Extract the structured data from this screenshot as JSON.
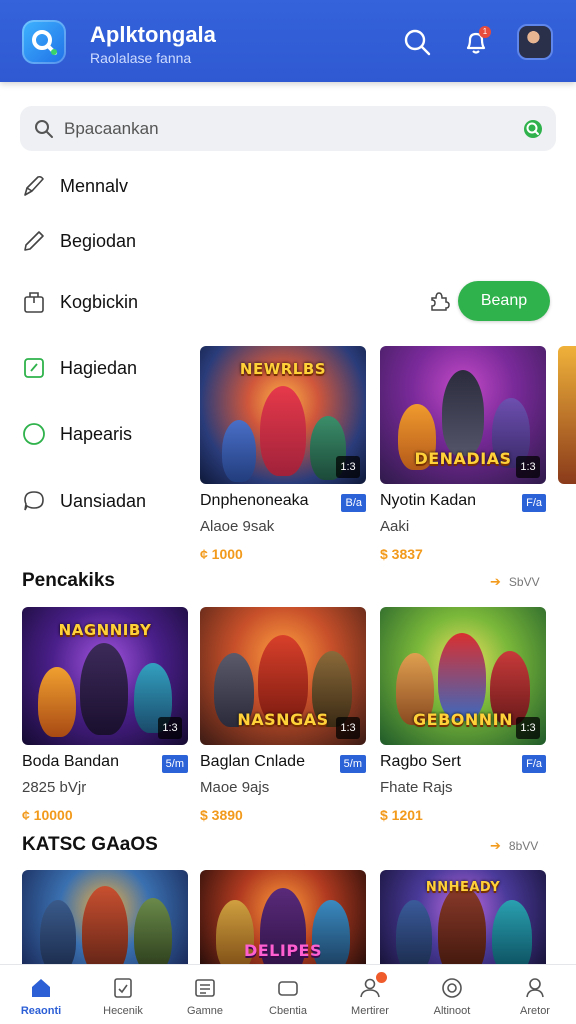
{
  "header": {
    "title": "Aplktongala",
    "subtitle": "Raolalase fanna",
    "notification_count": "1"
  },
  "search": {
    "placeholder": "Bpacaankan"
  },
  "menu": [
    {
      "label": "Mennalv",
      "icon": "pen-icon"
    },
    {
      "label": "Begiodan",
      "icon": "pencil-icon"
    },
    {
      "label": "Kogbickin",
      "icon": "bag-icon"
    },
    {
      "label": "Hagiedan",
      "icon": "clipboard-icon"
    },
    {
      "label": "Hapearis",
      "icon": "circle-icon"
    },
    {
      "label": "Uansiadan",
      "icon": "chat-icon"
    }
  ],
  "action_button": {
    "label": "Beanp"
  },
  "featured": [
    {
      "thumb_title": "NEWRLBS",
      "name": "Dnphenoneaka",
      "tag": "B/a",
      "sub": "Alaoe 9sak",
      "price": "¢ 1000",
      "badge": "1:3"
    },
    {
      "thumb_title": "DENADIAS",
      "name": "Nyotin Kadan",
      "tag": "F/a",
      "sub": "Aaki",
      "price": "$ 3837",
      "badge": "1:3"
    }
  ],
  "sections": [
    {
      "title": "Pencakiks",
      "see_all": "SbVV",
      "cards": [
        {
          "thumb_title": "NAGNNIBY",
          "name": "Boda Bandan",
          "tag": "5/m",
          "sub": "2825 bVjr",
          "price": "¢ 10000",
          "badge": "1:3"
        },
        {
          "thumb_title": "NASNGAS",
          "name": "Baglan Cnlade",
          "tag": "5/m",
          "sub": "Maoe 9ajs",
          "price": "$ 3890",
          "badge": "1:3"
        },
        {
          "thumb_title": "GEBONNIN",
          "name": "Ragbo Sert",
          "tag": "F/a",
          "sub": "Fhate Rajs",
          "price": "$ 1201",
          "badge": "1:3"
        }
      ]
    },
    {
      "title": "KATSC GAaOS",
      "see_all": "8bVV",
      "cards": [
        {
          "thumb_title": "",
          "name": "",
          "tag": "",
          "sub": "",
          "price": "",
          "badge": ""
        },
        {
          "thumb_title": "DELIPES",
          "name": "",
          "tag": "",
          "sub": "",
          "price": "",
          "badge": ""
        },
        {
          "thumb_title": "NNHEADY",
          "name": "",
          "tag": "",
          "sub": "",
          "price": "",
          "badge": ""
        }
      ]
    }
  ],
  "bottom_nav": [
    {
      "label": "Reaonti",
      "icon": "home-icon"
    },
    {
      "label": "Hecenik",
      "icon": "shield-icon"
    },
    {
      "label": "Gamne",
      "icon": "news-icon"
    },
    {
      "label": "Cbentia",
      "icon": "window-icon"
    },
    {
      "label": "Mertirer",
      "icon": "user-icon"
    },
    {
      "label": "Altinoot",
      "icon": "settings-icon"
    },
    {
      "label": "Aretor",
      "icon": "profile-icon"
    }
  ],
  "colors": {
    "header": "#3463db",
    "accent_green": "#2fb24b",
    "price_orange": "#f29a1c",
    "tag_blue": "#2c62d8"
  }
}
